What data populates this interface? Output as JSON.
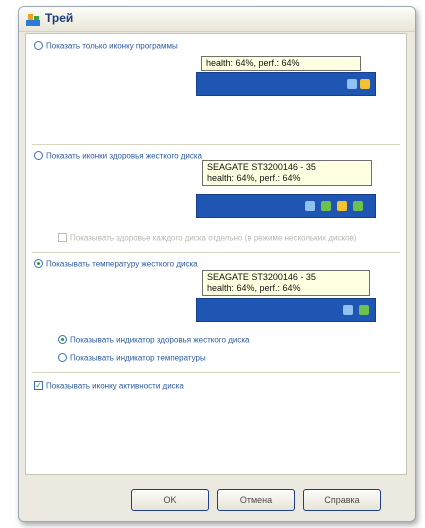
{
  "window": {
    "title": "Трей"
  },
  "options": {
    "icon_only": "Показать только иконку программы",
    "health_icons": "Показать иконки здоровья жесткого диска",
    "health_icons_sub": "Показывать здоровье каждого диска отдельно (в режиме нескольких дисков)",
    "temperature": "Показывать температуру жесткого диска",
    "health_indicator": "Показывать индикатор здоровья жесткого диска",
    "temp_indicator": "Показывать индикатор температуры",
    "activity_icon": "Показывать иконку активности диска"
  },
  "previews": {
    "tooltip1_line1": "health: 64%, perf.: 64%",
    "tooltip2_line1": "SEAGATE ST3200146 - 35",
    "tooltip2_line2": "health: 64%, perf.: 64%",
    "tooltip3_line1": "SEAGATE ST3200146 - 35",
    "tooltip3_line2": "health: 64%, perf.: 64%"
  },
  "buttons": {
    "ok": "OK",
    "cancel": "Отмена",
    "help": "Справка"
  }
}
